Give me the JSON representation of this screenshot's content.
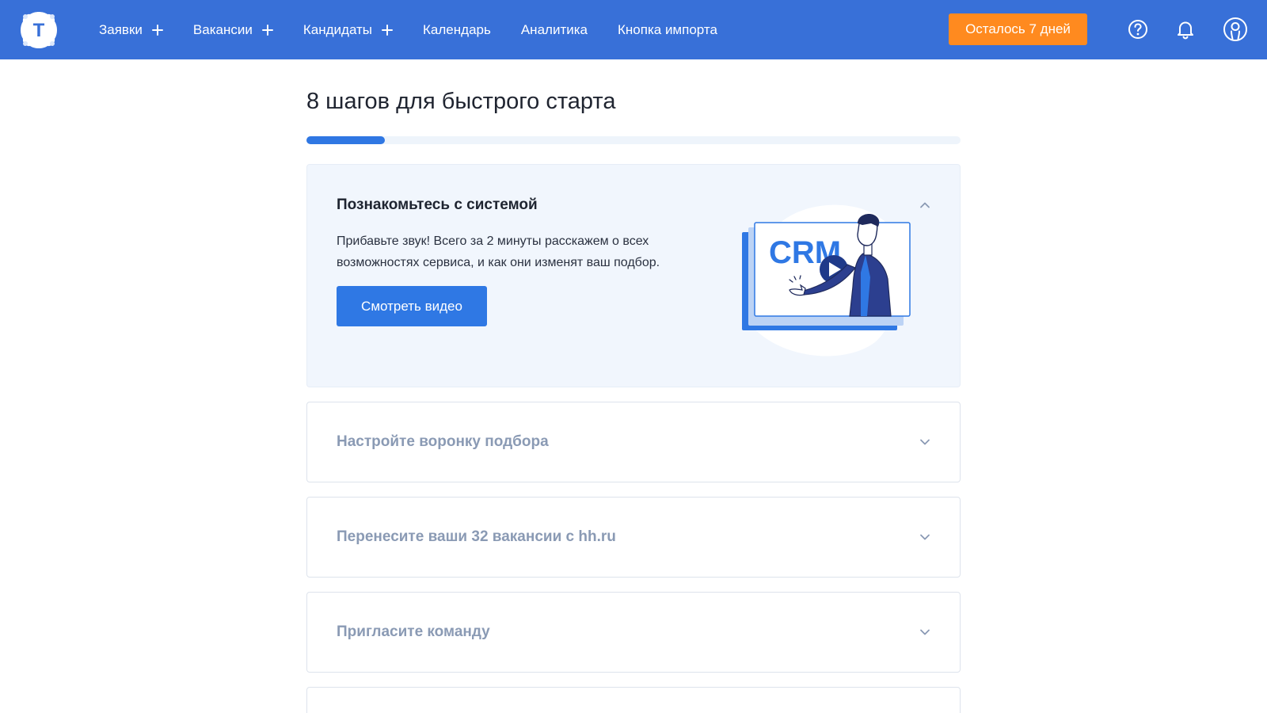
{
  "header": {
    "logo_letter": "T",
    "nav": [
      {
        "label": "Заявки",
        "has_plus": true
      },
      {
        "label": "Вакансии",
        "has_plus": true
      },
      {
        "label": "Кандидаты",
        "has_plus": true
      },
      {
        "label": "Календарь",
        "has_plus": false
      },
      {
        "label": "Аналитика",
        "has_plus": false
      },
      {
        "label": "Кнопка импорта",
        "has_plus": false
      }
    ],
    "trial_button": "Осталось 7 дней",
    "icons": [
      "help-icon",
      "bell-icon",
      "user-icon"
    ]
  },
  "main": {
    "title": "8 шагов для быстрого старта",
    "progress_fraction": 0.12,
    "steps": [
      {
        "title": "Познакомьтесь с системой",
        "expanded": true,
        "description": "Прибавьте звук! Всего за 2 минуты расскажем о всех возможностях сервиса, и как они изменят ваш подбор.",
        "button": "Смотреть видео",
        "illustration_text": "CRM"
      },
      {
        "title": "Настройте воронку подбора",
        "expanded": false
      },
      {
        "title": "Перенесите ваши 32 вакансии с hh.ru",
        "expanded": false
      },
      {
        "title": "Пригласите команду",
        "expanded": false
      },
      {
        "title": "",
        "expanded": false
      }
    ]
  },
  "colors": {
    "header_bg": "#3870d8",
    "accent_orange": "#ff8a1f",
    "primary_blue": "#2f78e4",
    "muted_title": "#8a9ab4",
    "open_card_bg": "#f1f6fd"
  }
}
